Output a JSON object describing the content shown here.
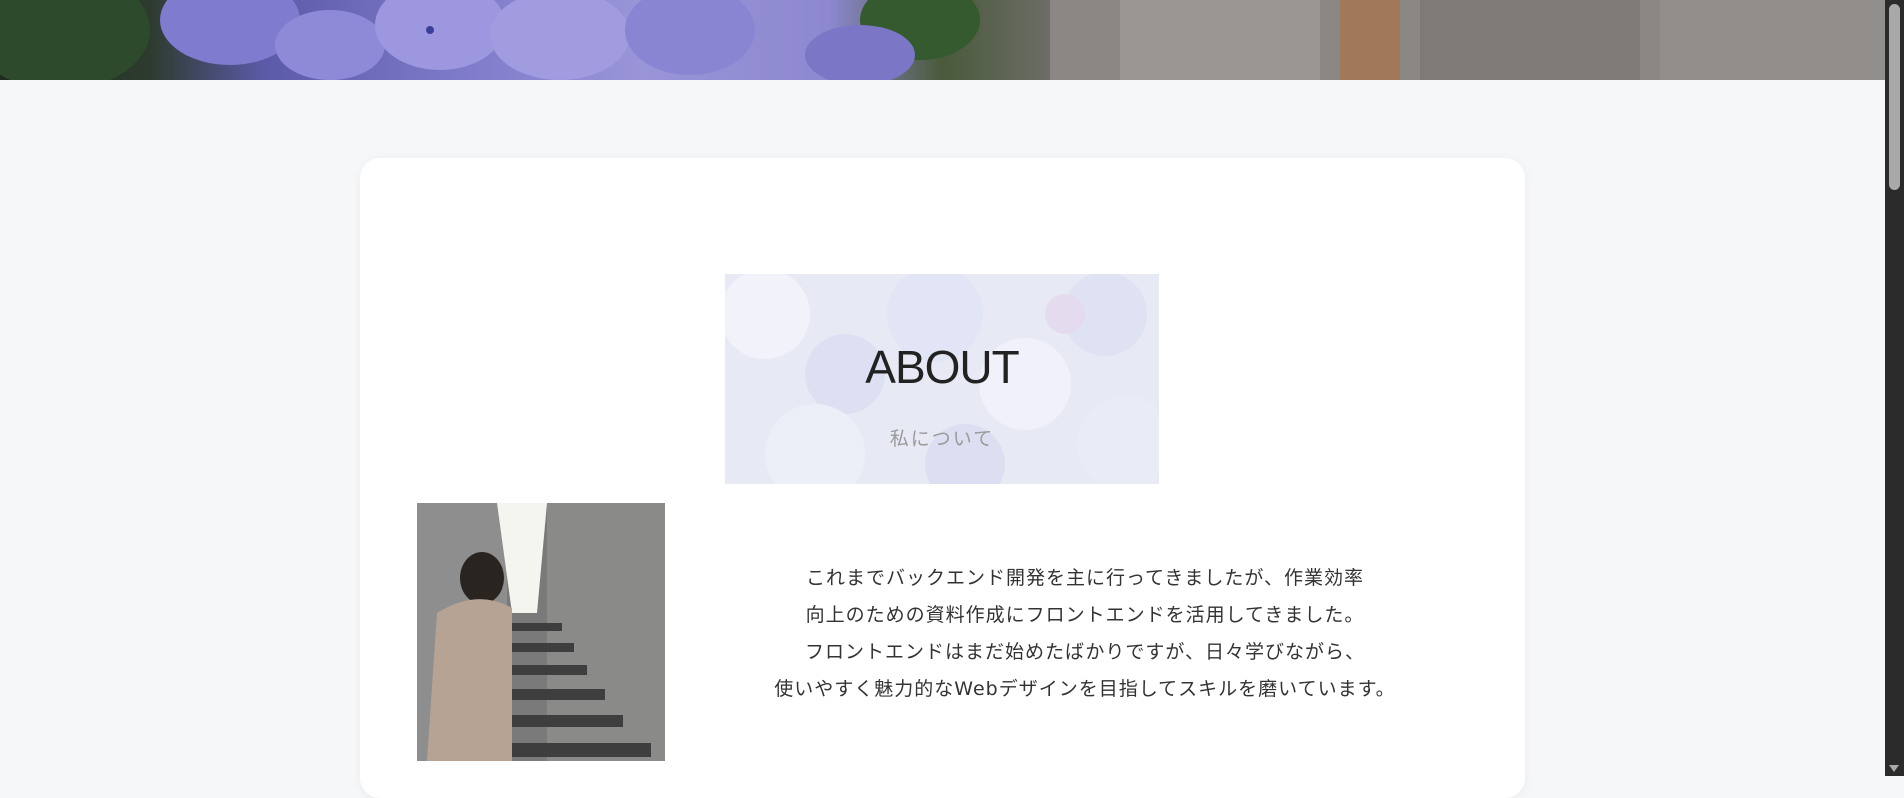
{
  "hero": {
    "image": "hydrangea-and-stone-path-photo"
  },
  "about": {
    "title": "ABOUT",
    "subtitle": "私について",
    "title_background": "hydrangea-petals-image",
    "photo": "person-on-stairs-photo",
    "bio_lines": [
      "これまでバックエンド開発を主に行ってきましたが、作業効率",
      "向上のための資料作成にフロントエンドを活用してきました。",
      "フロントエンドはまだ始めたばかりですが、日々学びながら、",
      "使いやすく魅力的なWebデザインを目指してスキルを磨いています。"
    ]
  },
  "colors": {
    "page_background": "#f6f7f9",
    "card": "#ffffff",
    "title": "#222222",
    "subtitle": "#9a9a9a",
    "accent": "#7d79c9"
  }
}
